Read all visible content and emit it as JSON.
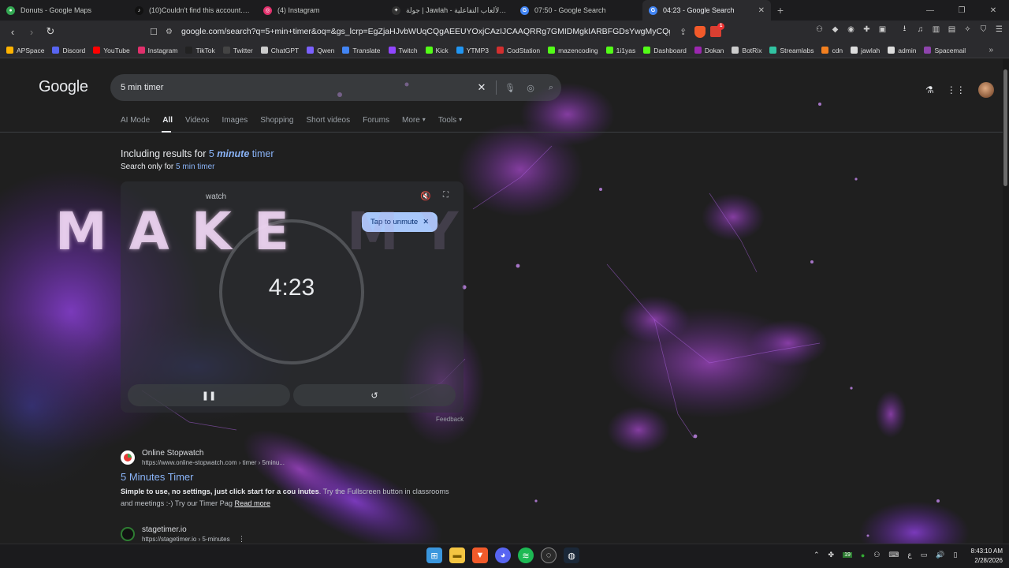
{
  "tabs": [
    {
      "title": "Donuts - Google Maps",
      "color": "#34a853",
      "glyph": "●"
    },
    {
      "title": "(10)Couldn't find this account. Visit T",
      "color": "#111111",
      "glyph": "♪"
    },
    {
      "title": "(4) Instagram",
      "color": "#e1306c",
      "glyph": "◎"
    },
    {
      "title": "جولة | Jawlah - منصة الألعاب التفاعلية",
      "color": "#333333",
      "glyph": "✦"
    },
    {
      "title": "07:50 - Google Search",
      "color": "#4285f4",
      "glyph": "G"
    },
    {
      "title": "04:23 - Google Search",
      "color": "#4285f4",
      "glyph": "G",
      "active": true
    }
  ],
  "omnibox": {
    "url": "google.com/search?q=5+min+timer&oq=&gs_lcrp=EgZjaHJvbWUqCQgAEEUYOxjCAzIJCAAQRRg7GMIDMgkIARBFGDsYwgMyCQgCEEUYOxjCAzIJCA..."
  },
  "bookmarks": [
    {
      "label": "APSpace",
      "color": "#ffb300"
    },
    {
      "label": "Discord",
      "color": "#5865f2"
    },
    {
      "label": "YouTube",
      "color": "#ff0000"
    },
    {
      "label": "Instagram",
      "color": "#e1306c"
    },
    {
      "label": "TikTok",
      "color": "#222222"
    },
    {
      "label": "Twitter",
      "color": "#444444"
    },
    {
      "label": "ChatGPT",
      "color": "#cccccc"
    },
    {
      "label": "Qwen",
      "color": "#7b61ff"
    },
    {
      "label": "Translate",
      "color": "#4285f4"
    },
    {
      "label": "Twitch",
      "color": "#9146ff"
    },
    {
      "label": "Kick",
      "color": "#53fc18"
    },
    {
      "label": "YTMP3",
      "color": "#2196f3"
    },
    {
      "label": "CodStation",
      "color": "#d32f2f"
    },
    {
      "label": "mazencoding",
      "color": "#53fc18"
    },
    {
      "label": "1i1yas",
      "color": "#53fc18"
    },
    {
      "label": "Dashboard",
      "color": "#53fc18"
    },
    {
      "label": "Dokan",
      "color": "#9c27b0"
    },
    {
      "label": "BotRix",
      "color": "#cccccc"
    },
    {
      "label": "Streamlabs",
      "color": "#31c3a2"
    },
    {
      "label": "cdn",
      "color": "#f38020"
    },
    {
      "label": "jawlah",
      "color": "#dddddd"
    },
    {
      "label": "admin",
      "color": "#dddddd"
    },
    {
      "label": "Spacemail",
      "color": "#8e44ad"
    }
  ],
  "google": {
    "logo": "Google",
    "query": "5 min timer",
    "filters": [
      "AI Mode",
      "All",
      "Videos",
      "Images",
      "Shopping",
      "Short videos",
      "Forums",
      "More",
      "Tools"
    ],
    "active_filter": "All"
  },
  "correction": {
    "including_prefix": "Including results for ",
    "including_num": "5 ",
    "including_bold": "minute",
    "including_rest": " timer",
    "only_prefix": "Search only for ",
    "only_link": "5 min timer"
  },
  "timer": {
    "tab_label": "watch",
    "tooltip": "Tap to unmute",
    "display": "4:23",
    "feedback": "Feedback"
  },
  "overlay_text": {
    "word1": "MAKE",
    "word2": "MY"
  },
  "results": [
    {
      "site": "Online Stopwatch",
      "url": "https://www.online-stopwatch.com › timer › 5minu...",
      "title": "5 Minutes Timer",
      "snippet_bold": "Simple to use, no settings, just click start for a cou",
      "snippet_bold2": "inutes",
      "snippet_rest": ". Try the Fullscreen button in classrooms and meetings :-) Try our Timer Pag",
      "read_more": "Read more"
    },
    {
      "site": "stagetimer.io",
      "url": "https://stagetimer.io › 5-minutes"
    }
  ],
  "taskbar": {
    "time": "8:43:10 AM",
    "date": "2/28/2026",
    "tray_badge": "19",
    "lang": "ع"
  }
}
